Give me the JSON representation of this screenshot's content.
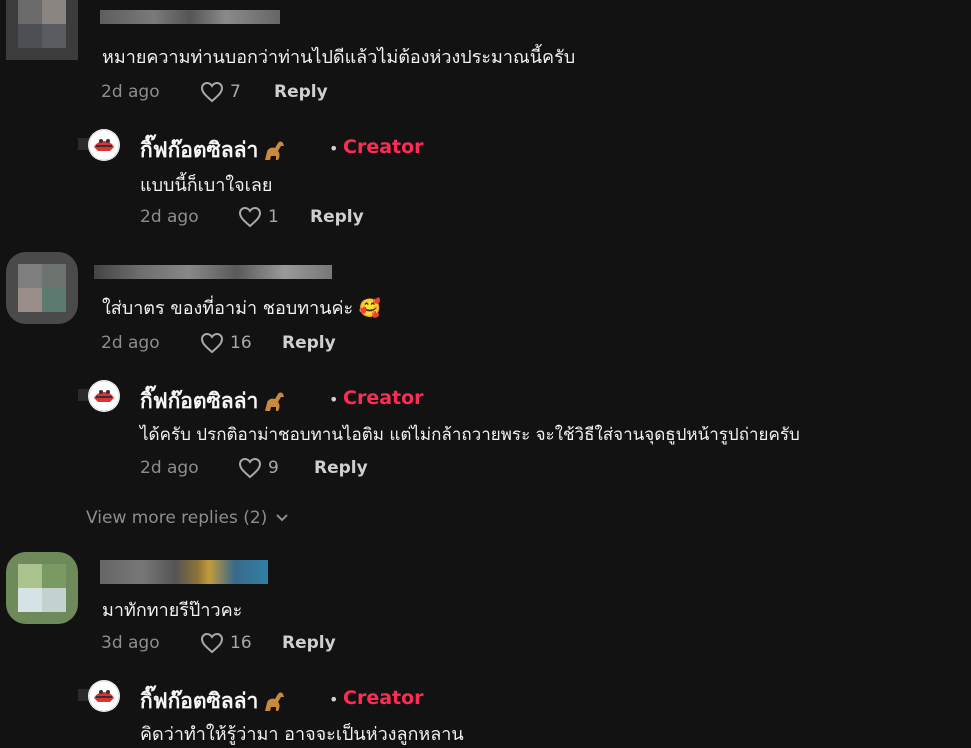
{
  "comments": [
    {
      "text": "หมายความท่านบอกว่าท่านไปดีแล้วไม่ต้องห่วงประมาณนี้ครับ",
      "time": "2d ago",
      "likes": "7",
      "reply_label": "Reply",
      "reply": {
        "author": "กิ๊ฟก๊อตซิลล่า",
        "creator_badge": "Creator",
        "text": "แบบนี้ก็เบาใจเลย",
        "time": "2d ago",
        "likes": "1",
        "reply_label": "Reply"
      }
    },
    {
      "text": "ใส่บาตร ของที่อาม่า ชอบทานค่ะ 🥰",
      "time": "2d ago",
      "likes": "16",
      "reply_label": "Reply",
      "reply": {
        "author": "กิ๊ฟก๊อตซิลล่า",
        "creator_badge": "Creator",
        "text": "ได้ครับ ปรกติอาม่าชอบทานไอติม แต่ไม่กล้าถวายพระ จะใช้วิธีใส่จานจุดธูปหน้ารูปถ่ายครับ",
        "time": "2d ago",
        "likes": "9",
        "reply_label": "Reply"
      },
      "view_more": "View more replies (2)"
    },
    {
      "text": "มาทักทายรีป๊าวคะ",
      "time": "3d ago",
      "likes": "16",
      "reply_label": "Reply",
      "reply": {
        "author": "กิ๊ฟก๊อตซิลล่า",
        "creator_badge": "Creator",
        "text": "คิดว่าทำให้รู้ว่ามา อาจจะเป็นห่วงลูกหลาน"
      }
    }
  ],
  "colors": {
    "background": "#121212",
    "creator": "#fe2c55",
    "muted": "#8d8d8d"
  }
}
